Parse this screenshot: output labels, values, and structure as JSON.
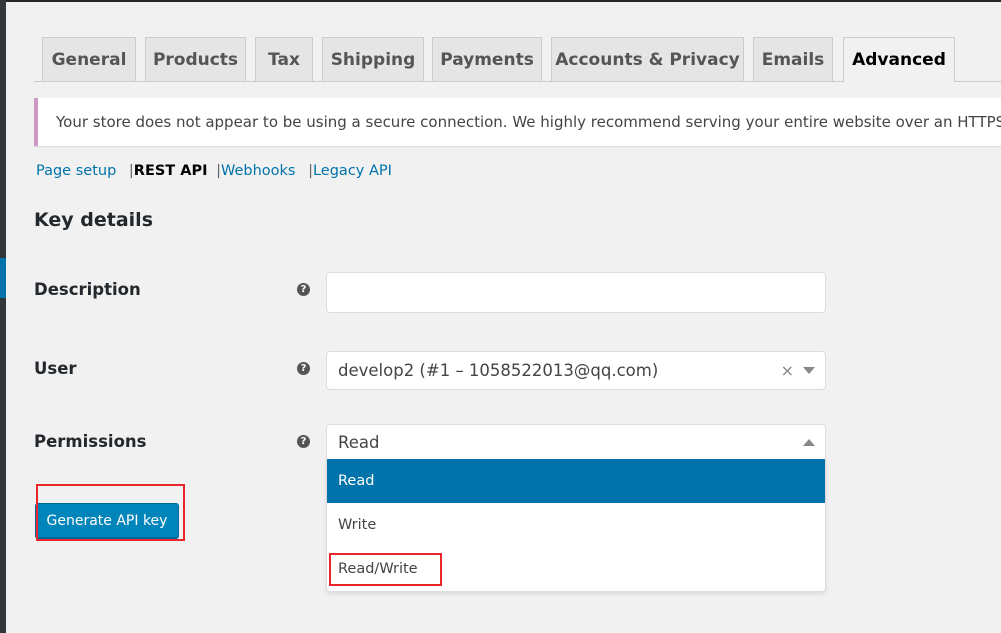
{
  "tabs": [
    {
      "label": "General"
    },
    {
      "label": "Products"
    },
    {
      "label": "Tax"
    },
    {
      "label": "Shipping"
    },
    {
      "label": "Payments"
    },
    {
      "label": "Accounts & Privacy"
    },
    {
      "label": "Emails"
    },
    {
      "label": "Advanced",
      "active": true
    }
  ],
  "notice": {
    "text": "Your store does not appear to be using a secure connection. We highly recommend serving your entire website over an HTTPS connection to help keep customer data secure.",
    "accent_color": "#cc99c2"
  },
  "subnav": {
    "items": [
      "Page setup",
      "REST API",
      "Webhooks",
      "Legacy API"
    ],
    "current": "REST API",
    "separator": "|"
  },
  "section_title": "Key details",
  "form": {
    "description": {
      "label": "Description",
      "help": "?",
      "value": ""
    },
    "user": {
      "label": "User",
      "help": "?",
      "value": "develop2 (#1 – 1058522013@qq.com)",
      "clear": "×"
    },
    "permissions": {
      "label": "Permissions",
      "help": "?",
      "value": "Read",
      "options": [
        "Read",
        "Write",
        "Read/Write"
      ],
      "highlighted": "Read"
    }
  },
  "generate_button": "Generate API key",
  "colors": {
    "primary": "#0085ba",
    "highlight": "#0073aa",
    "annotation": "#e8262b"
  }
}
